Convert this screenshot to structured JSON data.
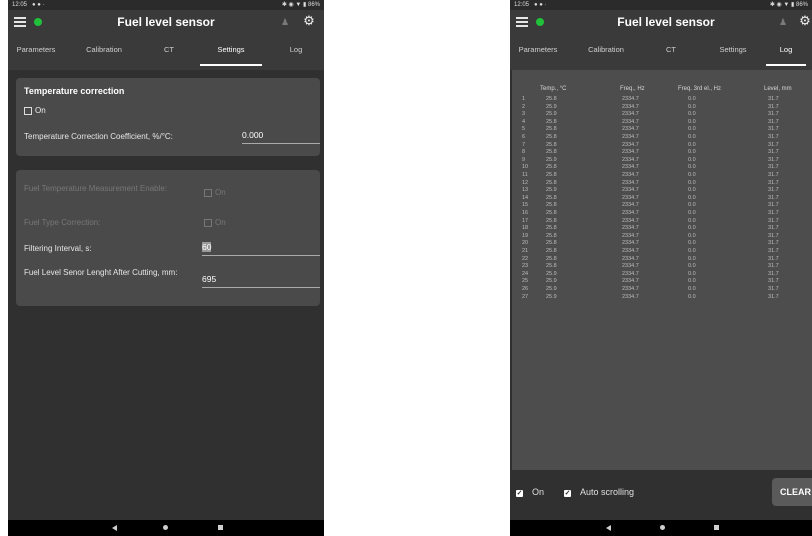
{
  "status_bar": {
    "time": "12:05",
    "icons": "● ● ·",
    "right": "✱ ◉ ▼ ▮ 86%"
  },
  "app": {
    "title": "Fuel level sensor",
    "connection_color": "#22c13a"
  },
  "tabs": [
    "Parameters",
    "Calibration",
    "CT",
    "Settings",
    "Log"
  ],
  "left": {
    "active_tab": "Settings",
    "temperature_card": {
      "title": "Temperature correction",
      "on_label": "On",
      "coeff_label": "Temperature Correction Coefficient, %/°C:",
      "coeff_value": "0.000"
    },
    "settings_card": {
      "fuel_temp_label": "Fuel Temperature Measurement Enable:",
      "fuel_temp_on": "On",
      "fuel_type_label": "Fuel Type Correction:",
      "fuel_type_on": "On",
      "filter_label": "Filtering Interval, s:",
      "filter_value": "60",
      "length_label": "Fuel Level Senor Lenght After Cutting, mm:",
      "length_value": "695"
    }
  },
  "right": {
    "active_tab": "Log",
    "log_headers": [
      "Temp., °C",
      "Freq., Hz",
      "Freq. 3rd el., Hz",
      "Level, mm"
    ],
    "log_rows": [
      [
        "1",
        "25.8",
        "2334.7",
        "0.0",
        "31.7"
      ],
      [
        "2",
        "25.9",
        "2334.7",
        "0.0",
        "31.7"
      ],
      [
        "3",
        "25.9",
        "2334.7",
        "0.0",
        "31.7"
      ],
      [
        "4",
        "25.8",
        "2334.7",
        "0.0",
        "31.7"
      ],
      [
        "5",
        "25.8",
        "2334.7",
        "0.0",
        "31.7"
      ],
      [
        "6",
        "25.8",
        "2334.7",
        "0.0",
        "31.7"
      ],
      [
        "7",
        "25.8",
        "2334.7",
        "0.0",
        "31.7"
      ],
      [
        "8",
        "25.8",
        "2334.7",
        "0.0",
        "31.7"
      ],
      [
        "9",
        "25.9",
        "2334.7",
        "0.0",
        "31.7"
      ],
      [
        "10",
        "25.8",
        "2334.7",
        "0.0",
        "31.7"
      ],
      [
        "11",
        "25.8",
        "2334.7",
        "0.0",
        "31.7"
      ],
      [
        "12",
        "25.8",
        "2334.7",
        "0.0",
        "31.7"
      ],
      [
        "13",
        "25.9",
        "2334.7",
        "0.0",
        "31.7"
      ],
      [
        "14",
        "25.8",
        "2334.7",
        "0.0",
        "31.7"
      ],
      [
        "15",
        "25.8",
        "2334.7",
        "0.0",
        "31.7"
      ],
      [
        "16",
        "25.8",
        "2334.7",
        "0.0",
        "31.7"
      ],
      [
        "17",
        "25.8",
        "2334.7",
        "0.0",
        "31.7"
      ],
      [
        "18",
        "25.8",
        "2334.7",
        "0.0",
        "31.7"
      ],
      [
        "19",
        "25.8",
        "2334.7",
        "0.0",
        "31.7"
      ],
      [
        "20",
        "25.8",
        "2334.7",
        "0.0",
        "31.7"
      ],
      [
        "21",
        "25.8",
        "2334.7",
        "0.0",
        "31.7"
      ],
      [
        "22",
        "25.8",
        "2334.7",
        "0.0",
        "31.7"
      ],
      [
        "23",
        "25.8",
        "2334.7",
        "0.0",
        "31.7"
      ],
      [
        "24",
        "25.9",
        "2334.7",
        "0.0",
        "31.7"
      ],
      [
        "25",
        "25.9",
        "2334.7",
        "0.0",
        "31.7"
      ],
      [
        "26",
        "25.9",
        "2334.7",
        "0.0",
        "31.7"
      ],
      [
        "27",
        "25.9",
        "2334.7",
        "0.0",
        "31.7"
      ]
    ],
    "on_label": "On",
    "autoscroll_label": "Auto scrolling",
    "clear_label": "CLEAR"
  }
}
